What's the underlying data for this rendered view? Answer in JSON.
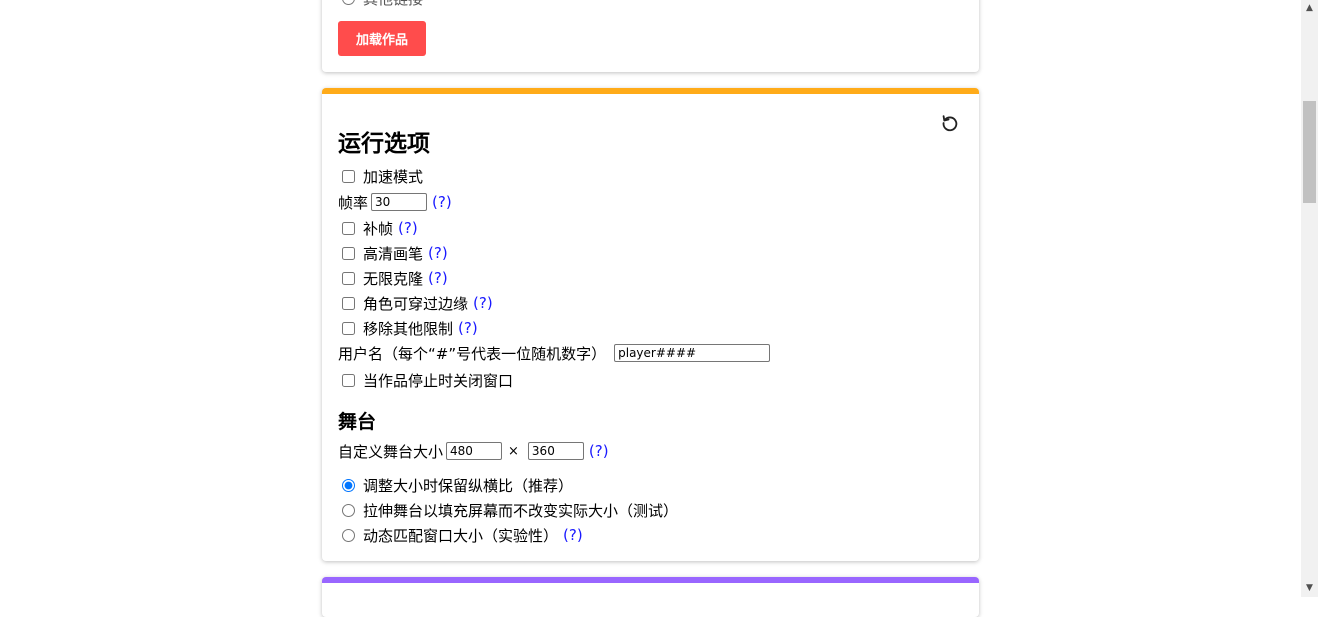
{
  "top_card": {
    "partial_radio_label": "其他链接",
    "load_button": "加载作品"
  },
  "run_options": {
    "title": "运行选项",
    "turbo": "加速模式",
    "framerate_label": "帧率",
    "framerate_value": "30",
    "help": "(?)",
    "interpolation": "补帧",
    "hq_pen": "高清画笔",
    "infinite_clones": "无限克隆",
    "fencing": "角色可穿过边缘",
    "remove_limits": "移除其他限制",
    "username_label": "用户名（每个“#”号代表一位随机数字）",
    "username_value": "player####",
    "close_on_stop": "当作品停止时关闭窗口",
    "stage_heading": "舞台",
    "stage_size_label": "自定义舞台大小",
    "stage_width": "480",
    "times": "×",
    "stage_height": "360",
    "resize_keep_aspect": "调整大小时保留纵横比（推荐）",
    "stretch_fill": "拉伸舞台以填充屏幕而不改变实际大小（测试）",
    "dynamic_resize": "动态匹配窗口大小（实验性）",
    "selected_resize_mode": "keep-aspect"
  },
  "colors": {
    "accent_orange": "#ffab19",
    "accent_purple": "#9966ff",
    "button_red": "#ff4c4c",
    "link_blue": "#1a1aff"
  },
  "icons": {
    "reset": "reset-icon"
  },
  "scrollbar": {
    "up_arrow": "▲",
    "down_arrow": "▼"
  }
}
